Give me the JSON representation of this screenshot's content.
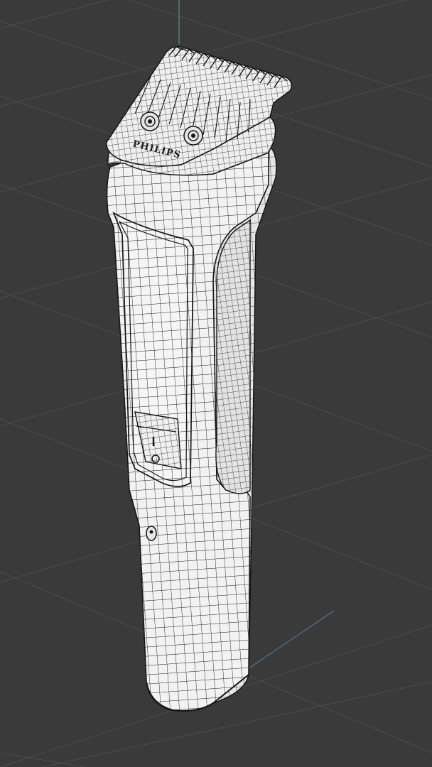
{
  "scene": {
    "background": "#3a3a3a",
    "grid_color": "#4c4c4c",
    "axis_y_color": "#3f9f86",
    "axis_x_color": "#4a7aa8",
    "model_color": "#f2f2f2",
    "wire_color": "#1c1c1c"
  },
  "model": {
    "brand_text": "PHILIPS",
    "icons": [
      "comb-attachment",
      "blade-screw-icon",
      "power-button-icon",
      "charge-port-icon"
    ]
  }
}
